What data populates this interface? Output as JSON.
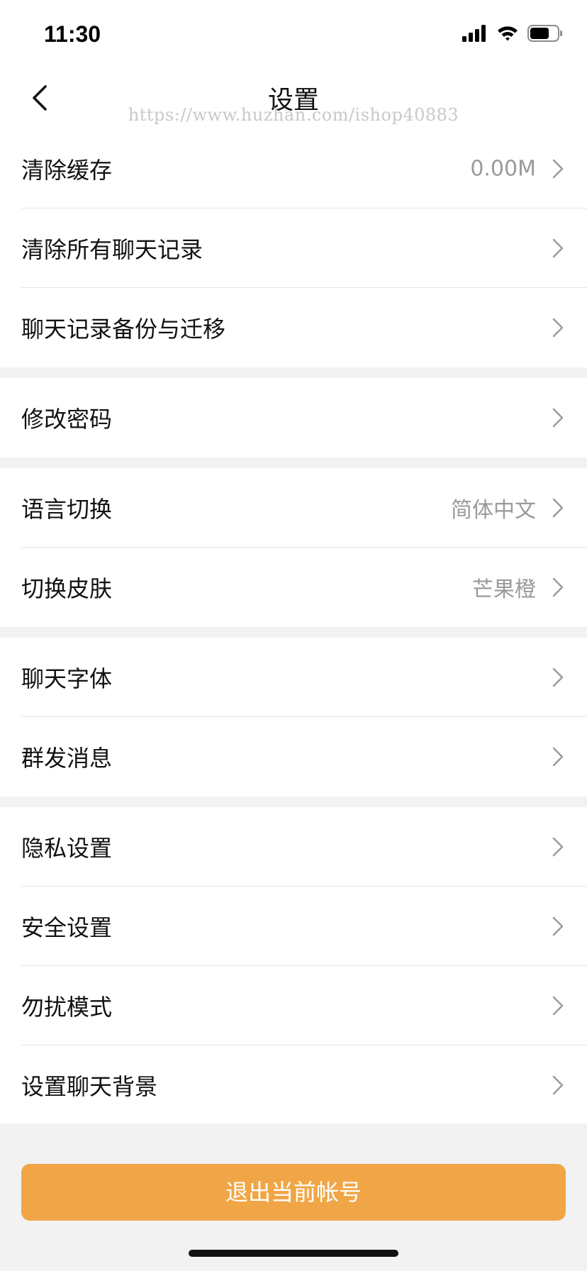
{
  "status_bar": {
    "time": "11:30",
    "icons": [
      "cellular-signal-icon",
      "wifi-icon",
      "battery-icon"
    ]
  },
  "nav": {
    "title": "设置",
    "watermark": "https://www.huzhan.com/ishop40883",
    "back_icon": "chevron-left-icon"
  },
  "groups": [
    {
      "rows": [
        {
          "label": "清除缓存",
          "value": "0.00M"
        },
        {
          "label": "清除所有聊天记录",
          "value": ""
        },
        {
          "label": "聊天记录备份与迁移",
          "value": ""
        }
      ]
    },
    {
      "rows": [
        {
          "label": "修改密码",
          "value": ""
        }
      ]
    },
    {
      "rows": [
        {
          "label": "语言切换",
          "value": "简体中文"
        },
        {
          "label": "切换皮肤",
          "value": "芒果橙"
        }
      ]
    },
    {
      "rows": [
        {
          "label": "聊天字体",
          "value": ""
        },
        {
          "label": "群发消息",
          "value": ""
        }
      ]
    },
    {
      "rows": [
        {
          "label": "隐私设置",
          "value": ""
        },
        {
          "label": "安全设置",
          "value": ""
        },
        {
          "label": "勿扰模式",
          "value": ""
        },
        {
          "label": "设置聊天背景",
          "value": ""
        }
      ]
    }
  ],
  "logout": {
    "label": "退出当前帐号"
  },
  "colors": {
    "accent": "#f0a646",
    "background": "#f2f2f2",
    "value_text": "#9a9a9a"
  }
}
